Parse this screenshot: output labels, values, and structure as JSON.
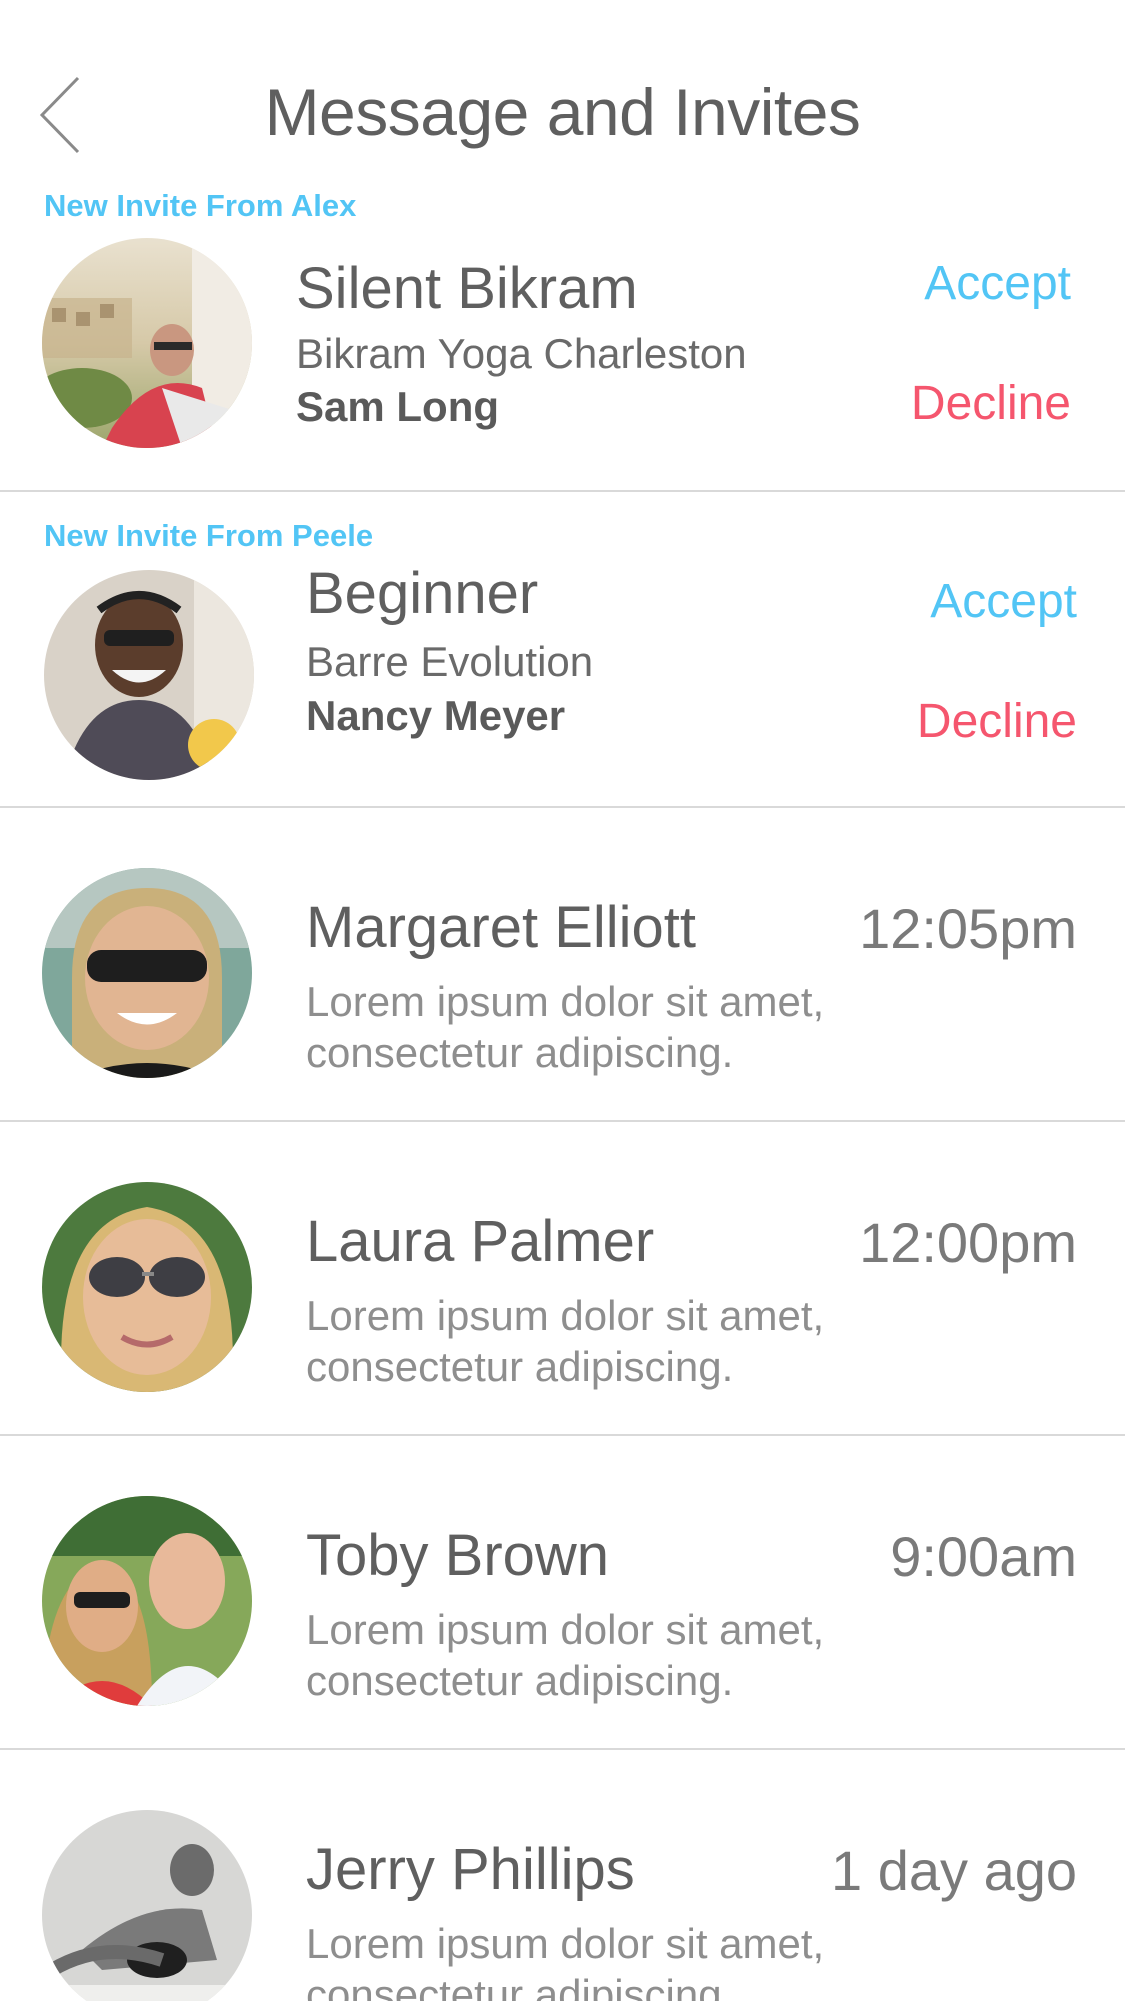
{
  "header": {
    "title": "Message and Invites"
  },
  "invites": [
    {
      "from_label": "New Invite From Alex",
      "class_name": "Silent Bikram",
      "studio": "Bikram Yoga Charleston",
      "host": "Sam Long",
      "accept_label": "Accept",
      "decline_label": "Decline"
    },
    {
      "from_label": "New Invite From Peele",
      "class_name": "Beginner",
      "studio": "Barre Evolution",
      "host": "Nancy Meyer",
      "accept_label": "Accept",
      "decline_label": "Decline"
    }
  ],
  "messages": [
    {
      "name": "Margaret Elliott",
      "time": "12:05pm",
      "preview": "Lorem ipsum dolor sit amet, consectetur adipiscing."
    },
    {
      "name": "Laura Palmer",
      "time": "12:00pm",
      "preview": "Lorem ipsum dolor sit amet, consectetur adipiscing."
    },
    {
      "name": "Toby Brown",
      "time": "9:00am",
      "preview": "Lorem ipsum dolor sit amet, consectetur adipiscing."
    },
    {
      "name": "Jerry Phillips",
      "time": "1 day ago",
      "preview": "Lorem ipsum dolor sit amet, consectetur adipiscing."
    }
  ],
  "colors": {
    "accent_blue": "#52c5f5",
    "decline_red": "#f5566e",
    "text_dark": "#5f5f5f",
    "text_light": "#8e8e8e",
    "divider": "#d9d9d9"
  },
  "icons": {
    "back": "chevron-left-icon"
  }
}
